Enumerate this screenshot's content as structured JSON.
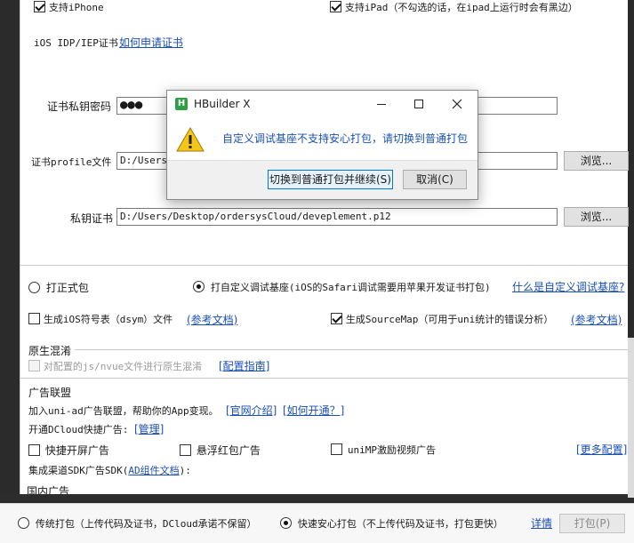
{
  "platform": {
    "support_iphone": "支持iPhone",
    "support_ipad": "支持iPad（不勾选的话，在ipad上运行时会有黑边）"
  },
  "cert": {
    "idp_label": "iOS IDP/IEP证书",
    "apply_link": "如何申请证书",
    "password_label": "证书私钥密码",
    "password_value": "●●●",
    "profile_label": "证书profile文件",
    "profile_value": "D:/Users/",
    "profile_browse": "浏览...",
    "private_key_label": "私钥证书",
    "private_key_value": "D:/Users/Desktop/ordersysCloud/deveplement.p12",
    "private_key_browse": "浏览..."
  },
  "package_type": {
    "formal": "打正式包",
    "custom_debug": "打自定义调试基座(iOS的Safari调试需要用苹果开发证书打包)",
    "what_is_link": "什么是自定义调试基座?"
  },
  "symbols": {
    "dsym_label": "生成iOS符号表（dsym）文件",
    "dsym_doc": "(参考文档)",
    "sourcemap_label": "生成SourceMap（可用于uni统计的错误分析）",
    "sourcemap_doc": "(参考文档)"
  },
  "native_mix": {
    "title": "原生混淆",
    "obfuscate_label": "对配置的js/nvue文件进行原生混淆",
    "guide_link": "[配置指南]"
  },
  "ad": {
    "title": "广告联盟",
    "join_text": "加入uni-ad广告联盟，帮助你的App变现。",
    "intro_link": "[官网介绍]",
    "how_link": "[如何开通？]",
    "open_text": "开通DCloud快捷广告:",
    "manage_link": "[管理]",
    "splash": "快捷开屏广告",
    "float_red": "悬浮红包广告",
    "unimp_video": "uniMP激励视频广告",
    "more_link": "[更多配置]",
    "sdk_text_prefix": "集成渠道SDK广告SDK(",
    "sdk_link": "AD组件文档",
    "sdk_text_suffix": "):",
    "domestic": "国内广告"
  },
  "bottom": {
    "traditional": "传统打包（上传代码及证书，DCloud承诺不保留）",
    "fast_safe": "快速安心打包（不上传代码及证书，打包更快）",
    "details_link": "详情",
    "pack_button": "打包(P)"
  },
  "dialog": {
    "title": "HBuilder X",
    "message": "自定义调试基座不支持安心打包，请切换到普通打包",
    "switch_button": "切换到普通打包并继续(S)",
    "cancel_button": "取消(C)"
  },
  "colors": {
    "link": "#1a4fb8",
    "dialog_message": "#1a52b0",
    "hbuilder_logo": "#2ea043",
    "warning": "#f5c518"
  }
}
